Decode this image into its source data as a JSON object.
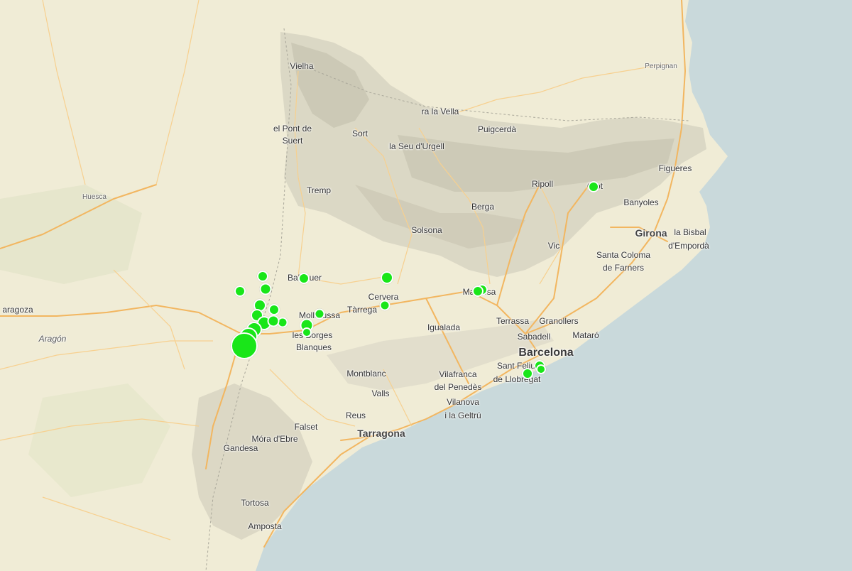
{
  "map": {
    "colors": {
      "land": "#f0ecd6",
      "sea": "#c9d9db",
      "marker": "#19e619",
      "marker_border": "#ffffff",
      "road_major": "#f2b660",
      "road_minor": "#f7d08f",
      "mountain": "#cfcdbb"
    },
    "labels": {
      "vielha": "Vielha",
      "pont_suert_1": "el Pont de",
      "pont_suert_2": "Suert",
      "sort": "Sort",
      "vella": "ra la Vella",
      "puigcerda": "Puigcerdà",
      "seu_urgell": "la Seu d'Urgell",
      "perpignan": "Perpignan",
      "figueres": "Figueres",
      "huesca": "Huesca",
      "tremp": "Tremp",
      "ripoll": "Ripoll",
      "olot": "Olot",
      "banyoles": "Banyoles",
      "berga": "Berga",
      "solsona": "Solsona",
      "girona": "Girona",
      "bisbal_1": "la Bisbal",
      "bisbal_2": "d'Empordà",
      "vic": "Vic",
      "santa_coloma_1": "Santa Coloma",
      "santa_coloma_2": "de Farners",
      "balaguer": "Balaguer",
      "cervera": "Cervera",
      "manresa": "Manresa",
      "zaragoza": "aragoza",
      "mollerussa": "Mollerussa",
      "tarrega": "Tàrrega",
      "aragon": "Aragón",
      "borges_1": "les Borges",
      "borges_2": "Blanques",
      "igualada": "Igualada",
      "terrassa": "Terrassa",
      "granollers": "Granollers",
      "sabadell": "Sabadell",
      "mataro": "Mataró",
      "barcelona": "Barcelona",
      "sant_feliu_1": "Sant Feliu",
      "sant_feliu_2": "de Llobregat",
      "montblanc": "Montblanc",
      "vilafranca_1": "Vilafranca",
      "vilafranca_2": "del Penedès",
      "valls": "Valls",
      "vilanova_1": "Vilanova",
      "vilanova_2": "i la Geltrú",
      "reus": "Reus",
      "falset": "Falset",
      "tarragona": "Tarragona",
      "mora": "Móra d'Ebre",
      "gandesa": "Gandesa",
      "tortosa": "Tortosa",
      "amposta": "Amposta"
    }
  }
}
